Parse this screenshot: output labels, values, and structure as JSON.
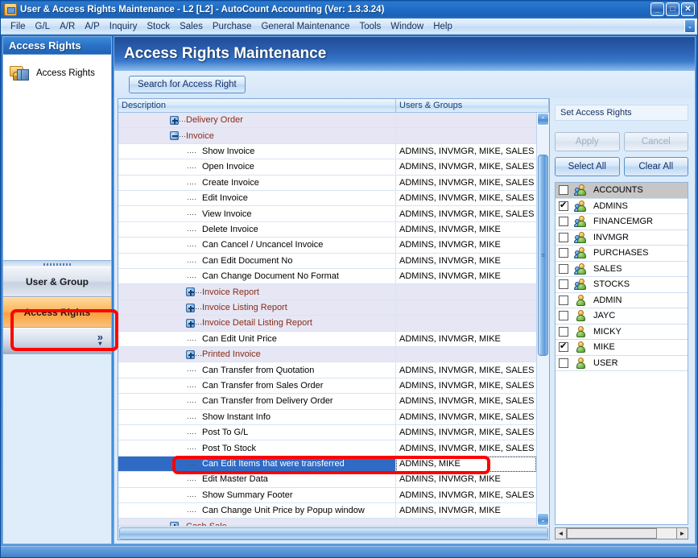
{
  "window": {
    "title": "User & Access Rights Maintenance - L2 [L2] - AutoCount Accounting (Ver: 1.3.3.24)",
    "minimize": "_",
    "maximize": "□",
    "close": "✕",
    "menu_overflow": "⌄"
  },
  "menubar": {
    "items": [
      {
        "label": "File"
      },
      {
        "label": "G/L"
      },
      {
        "label": "A/R"
      },
      {
        "label": "A/P"
      },
      {
        "label": "Inquiry"
      },
      {
        "label": "Stock"
      },
      {
        "label": "Sales"
      },
      {
        "label": "Purchase"
      },
      {
        "label": "General Maintenance"
      },
      {
        "label": "Tools"
      },
      {
        "label": "Window"
      },
      {
        "label": "Help"
      }
    ]
  },
  "sidebar": {
    "header": "Access Rights",
    "entry": {
      "label": "Access Rights",
      "icon": "access-rights-icon"
    },
    "buttons": [
      {
        "label": "User & Group",
        "active": false
      },
      {
        "label": "Access Rights",
        "active": true
      }
    ],
    "expander": "»"
  },
  "main": {
    "page_title": "Access Rights Maintenance",
    "search_button": "Search for Access Right"
  },
  "grid": {
    "columns": [
      "Description",
      "Users & Groups"
    ],
    "rows": [
      {
        "desc": "Delivery Order",
        "users": "",
        "type": "group",
        "level": 3,
        "expanded": false
      },
      {
        "desc": "Invoice",
        "users": "",
        "type": "group",
        "level": 3,
        "expanded": true
      },
      {
        "desc": "Show Invoice",
        "users": "ADMINS, INVMGR, MIKE, SALES",
        "type": "leaf",
        "level": 4
      },
      {
        "desc": "Open Invoice",
        "users": "ADMINS, INVMGR, MIKE, SALES",
        "type": "leaf",
        "level": 4
      },
      {
        "desc": "Create Invoice",
        "users": "ADMINS, INVMGR, MIKE, SALES",
        "type": "leaf",
        "level": 4
      },
      {
        "desc": "Edit Invoice",
        "users": "ADMINS, INVMGR, MIKE, SALES",
        "type": "leaf",
        "level": 4
      },
      {
        "desc": "View Invoice",
        "users": "ADMINS, INVMGR, MIKE, SALES",
        "type": "leaf",
        "level": 4
      },
      {
        "desc": "Delete Invoice",
        "users": "ADMINS, INVMGR, MIKE",
        "type": "leaf",
        "level": 4
      },
      {
        "desc": "Can Cancel / Uncancel Invoice",
        "users": "ADMINS, INVMGR, MIKE",
        "type": "leaf",
        "level": 4
      },
      {
        "desc": "Can Edit Document No",
        "users": "ADMINS, INVMGR, MIKE",
        "type": "leaf",
        "level": 4
      },
      {
        "desc": "Can Change Document No Format",
        "users": "ADMINS, INVMGR, MIKE",
        "type": "leaf",
        "level": 4
      },
      {
        "desc": "Invoice Report",
        "users": "",
        "type": "group",
        "level": 4,
        "expanded": false
      },
      {
        "desc": "Invoice Listing Report",
        "users": "",
        "type": "group",
        "level": 4,
        "expanded": false
      },
      {
        "desc": "Invoice Detail Listing Report",
        "users": "",
        "type": "group",
        "level": 4,
        "expanded": false
      },
      {
        "desc": "Can Edit Unit Price",
        "users": "ADMINS, INVMGR, MIKE",
        "type": "leaf",
        "level": 4
      },
      {
        "desc": "Printed Invoice",
        "users": "",
        "type": "group",
        "level": 4,
        "expanded": false
      },
      {
        "desc": "Can Transfer from Quotation",
        "users": "ADMINS, INVMGR, MIKE, SALES",
        "type": "leaf",
        "level": 4
      },
      {
        "desc": "Can Transfer from Sales Order",
        "users": "ADMINS, INVMGR, MIKE, SALES",
        "type": "leaf",
        "level": 4
      },
      {
        "desc": "Can Transfer from Delivery Order",
        "users": "ADMINS, INVMGR, MIKE, SALES",
        "type": "leaf",
        "level": 4
      },
      {
        "desc": "Show Instant Info",
        "users": "ADMINS, INVMGR, MIKE, SALES",
        "type": "leaf",
        "level": 4
      },
      {
        "desc": "Post To G/L",
        "users": "ADMINS, INVMGR, MIKE, SALES",
        "type": "leaf",
        "level": 4
      },
      {
        "desc": "Post To Stock",
        "users": "ADMINS, INVMGR, MIKE, SALES",
        "type": "leaf",
        "level": 4
      },
      {
        "desc": "Can Edit Items that were transferred",
        "users": "ADMINS, MIKE",
        "type": "leaf",
        "level": 4,
        "selected": true
      },
      {
        "desc": "Edit Master Data",
        "users": "ADMINS, INVMGR, MIKE",
        "type": "leaf",
        "level": 4
      },
      {
        "desc": "Show Summary Footer",
        "users": "ADMINS, INVMGR, MIKE, SALES",
        "type": "leaf",
        "level": 4
      },
      {
        "desc": "Can Change Unit Price by Popup window",
        "users": "ADMINS, INVMGR, MIKE",
        "type": "leaf",
        "level": 4
      },
      {
        "desc": "Cash Sale",
        "users": "",
        "type": "group",
        "level": 3,
        "expanded": false
      }
    ]
  },
  "right_panel": {
    "set_rights_label": "Set Access Rights",
    "apply_button": "Apply",
    "cancel_button": "Cancel",
    "select_all_button": "Select All",
    "clear_all_button": "Clear All",
    "users": [
      {
        "name": "ACCOUNTS",
        "checked": false,
        "kind": "group",
        "highlighted": true
      },
      {
        "name": "ADMINS",
        "checked": true,
        "kind": "group",
        "highlighted": false
      },
      {
        "name": "FINANCEMGR",
        "checked": false,
        "kind": "group",
        "highlighted": false
      },
      {
        "name": "INVMGR",
        "checked": false,
        "kind": "group",
        "highlighted": false
      },
      {
        "name": "PURCHASES",
        "checked": false,
        "kind": "group",
        "highlighted": false
      },
      {
        "name": "SALES",
        "checked": false,
        "kind": "group",
        "highlighted": false
      },
      {
        "name": "STOCKS",
        "checked": false,
        "kind": "group",
        "highlighted": false
      },
      {
        "name": "ADMIN",
        "checked": false,
        "kind": "user",
        "highlighted": false
      },
      {
        "name": "JAYC",
        "checked": false,
        "kind": "user",
        "highlighted": false
      },
      {
        "name": "MICKY",
        "checked": false,
        "kind": "user",
        "highlighted": false
      },
      {
        "name": "MIKE",
        "checked": true,
        "kind": "user",
        "highlighted": false
      },
      {
        "name": "USER",
        "checked": false,
        "kind": "user",
        "highlighted": false
      }
    ]
  },
  "scrollbars": {
    "up_arrow": "⌃",
    "down_arrow": "⌄",
    "left_arrow": "◄",
    "right_arrow": "►"
  },
  "colors": {
    "accent": "#1F63B5",
    "active_nav": "#F7A23F",
    "selection": "#2F6BC4",
    "group_row": "#E6E6F5",
    "group_text": "#8A2B14",
    "annotation": "#FF0000"
  }
}
